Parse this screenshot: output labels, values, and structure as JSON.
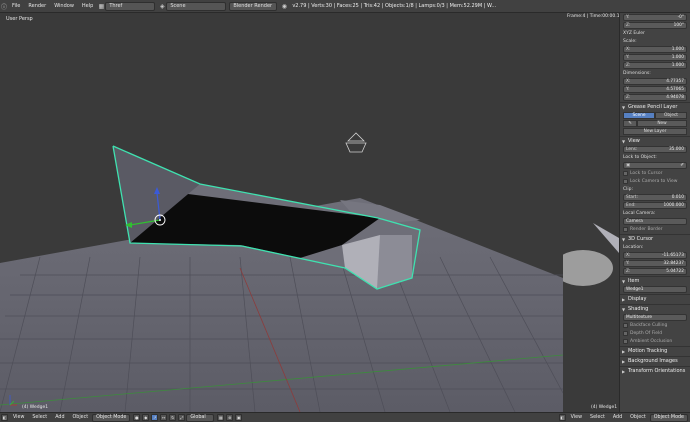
{
  "topbar": {
    "menus": [
      "File",
      "Render",
      "Window",
      "Help"
    ],
    "screen": "Thref",
    "scene": "Scene",
    "engine": "Blender Render",
    "stats": "v2.79 | Verts:30 | Faces:25 | Tris:42 | Objects:1/8 | Lamps:0/3 | Mem:52.29M | W..."
  },
  "viewport": {
    "label": "User Persp",
    "object_label": "(4) Wedge1"
  },
  "viewport2": {
    "frame_label": "Frame:4 | Time:00:00.10",
    "object_label": "(4) Wedge1"
  },
  "npanel": {
    "rotation": [
      {
        "k": "Y:",
        "v": "-0°"
      },
      {
        "k": "Z:",
        "v": "100°"
      }
    ],
    "rot_mode": "XYZ Euler",
    "scale_label": "Scale:",
    "scale": [
      {
        "k": "X:",
        "v": "1.000"
      },
      {
        "k": "Y:",
        "v": "1.000"
      },
      {
        "k": "Z:",
        "v": "1.000"
      }
    ],
    "dimensions_label": "Dimensions:",
    "dimensions": [
      {
        "k": "X:",
        "v": "4.77357"
      },
      {
        "k": "Y:",
        "v": "4.57065"
      },
      {
        "k": "Z:",
        "v": "4.94078"
      }
    ],
    "gp_header": "Grease Pencil Layer",
    "gp_tabs": [
      "Scene",
      "Object"
    ],
    "gp_new": "New",
    "gp_new_layer": "New Layer",
    "view_header": "View",
    "lens": {
      "k": "Lens:",
      "v": "35.000"
    },
    "lock_to_object": "Lock to Object:",
    "lock_to_cursor": "Lock to Cursor",
    "lock_camera": "Lock Camera to View",
    "clip": "Clip:",
    "clip_start": {
      "k": "Start:",
      "v": "0.010"
    },
    "clip_end": {
      "k": "End:",
      "v": "1000.000"
    },
    "local_camera": "Local Camera:",
    "camera": "Camera",
    "render_border": "Render Border",
    "cursor_header": "3D Cursor",
    "location": "Location:",
    "cursor": [
      {
        "k": "X:",
        "v": "-11.65173"
      },
      {
        "k": "Y:",
        "v": "32.84237"
      },
      {
        "k": "Z:",
        "v": "5.04722"
      }
    ],
    "item_header": "Item",
    "item_name": "Wedge1",
    "display_header": "Display",
    "shading_header": "Shading",
    "shading_mode": "Multitexture",
    "backface": "Backface Culling",
    "depth_of_field": "Depth Of Field",
    "ambient_occ": "Ambient Occlusion",
    "motion_tracking": "Motion Tracking",
    "background_images": "Background Images",
    "transform_orient": "Transform Orientations"
  },
  "bottombar": {
    "left": [
      "View",
      "Select",
      "Add",
      "Object"
    ],
    "mode": "Object Mode",
    "orientation": "Global",
    "right": [
      "View",
      "Select",
      "Add",
      "Object"
    ],
    "mode2": "Object Mode"
  }
}
